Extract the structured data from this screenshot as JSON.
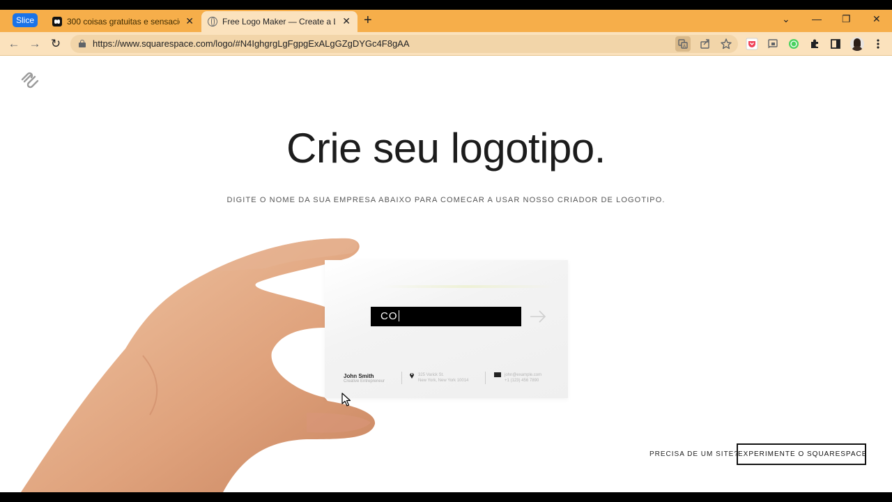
{
  "browser": {
    "tab_group_label": "Slice",
    "tabs": [
      {
        "title": "300 coisas gratuitas e sensacionais",
        "close": "✕"
      },
      {
        "title": "Free Logo Maker — Create a Logo",
        "close": "✕"
      }
    ],
    "new_tab": "+",
    "window_controls": {
      "menu": "⌄",
      "minimize": "—",
      "restore": "❐",
      "close": "✕"
    },
    "nav": {
      "back": "←",
      "forward": "→",
      "reload": "↻"
    },
    "url": "https://www.squarespace.com/logo/#N4IghgrgLgFgpgExALgGZgDYGc4F8gAA",
    "omnibox_icons": [
      "translate-icon",
      "share-icon",
      "star-icon"
    ],
    "extensions": [
      "pocket-extension-icon",
      "cast-icon",
      "whatsapp-extension-icon",
      "puzzle-extensions-icon",
      "side-panel-icon",
      "profile-avatar",
      "kebab-menu-icon"
    ]
  },
  "page": {
    "headline": "Crie seu logotipo.",
    "subheading": "DIGITE O NOME DA SUA EMPRESA ABAIXO PARA COMECAR A USAR NOSSO CRIADOR DE LOGOTIPO.",
    "business_input": {
      "value": "CO"
    },
    "card": {
      "name": "John Smith",
      "role": "Creative Entrepreneur",
      "address_line1": "325 Varick St.",
      "address_line2": "New York, New York 10014",
      "email": "john@example.com",
      "phone": "+1 (123) 456 7890"
    },
    "footer": {
      "need_site": "PRECISA DE UM SITE?",
      "cta": "EXPERIMENTE O SQUARESPACE"
    }
  },
  "colors": {
    "tabstrip": "#f6ae4a",
    "toolbar": "#fbe2bd",
    "group_chip": "#1a73e8",
    "input_bg": "#000000"
  }
}
